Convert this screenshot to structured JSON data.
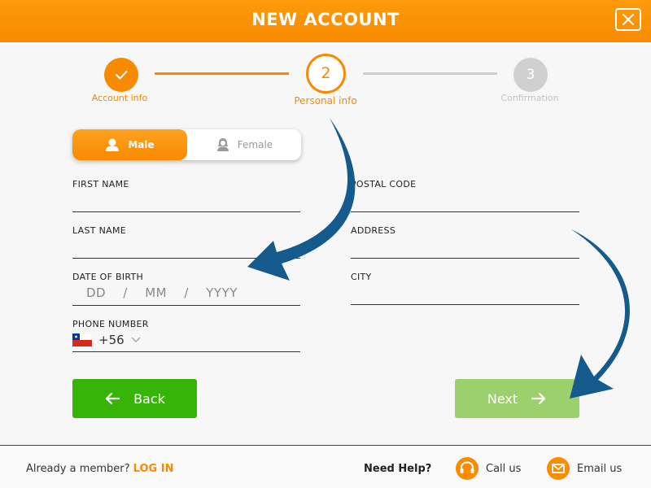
{
  "header": {
    "title": "NEW ACCOUNT"
  },
  "stepper": {
    "steps": [
      {
        "label": "Account info",
        "number": "✓",
        "state": "complete"
      },
      {
        "label": "Personal info",
        "number": "2",
        "state": "active"
      },
      {
        "label": "Confirmation",
        "number": "3",
        "state": "pending"
      }
    ]
  },
  "gender": {
    "male": "Male",
    "female": "Female",
    "selected": "Male"
  },
  "form": {
    "first_name": "FIRST NAME",
    "last_name": "LAST NAME",
    "date_of_birth": "DATE OF BIRTH",
    "dob_placeholder": {
      "day": "DD",
      "sep": "/",
      "month": "MM",
      "year": "YYYY"
    },
    "phone_number": "PHONE NUMBER",
    "phone_code": "+56",
    "postal_code": "POSTAL CODE",
    "address": "ADDRESS",
    "city": "CITY"
  },
  "buttons": {
    "back": "Back",
    "next": "Next"
  },
  "footer": {
    "member_text": "Already a member?",
    "login": "LOG IN",
    "need_help": "Need Help?",
    "call_us": "Call us",
    "email_us": "Email us"
  },
  "colors": {
    "accent": "#f78a00",
    "back_button": "#36b407",
    "next_button": "#9bd06d",
    "annotation_arrow": "#145a8c"
  }
}
